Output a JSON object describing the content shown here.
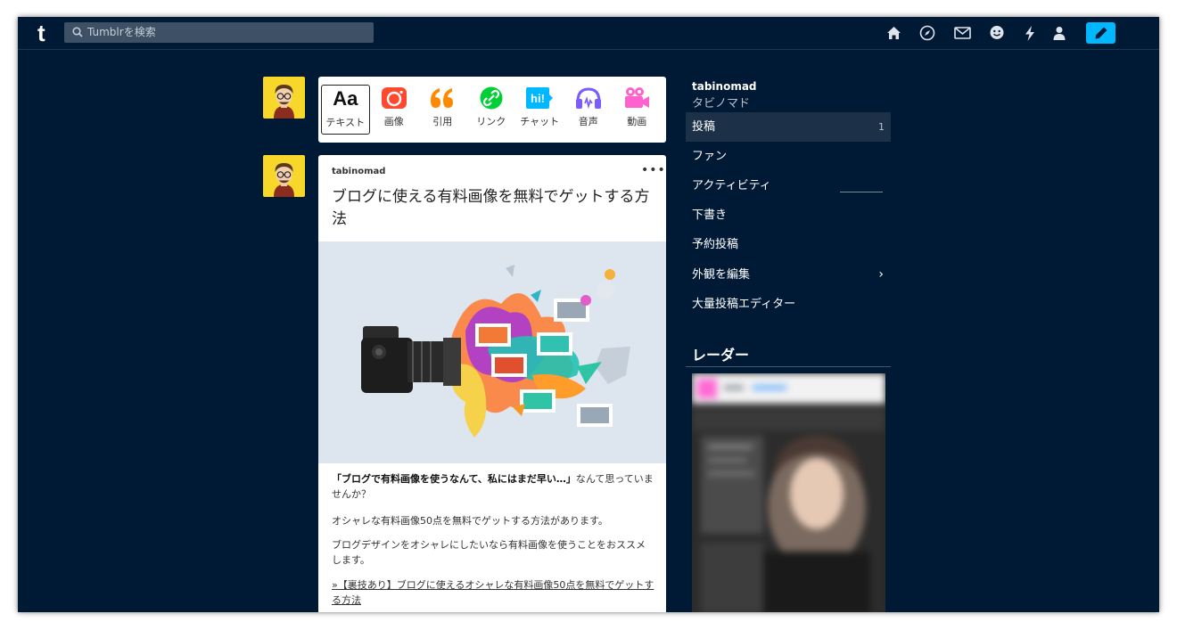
{
  "topbar": {
    "logo": "t",
    "search_placeholder": "Tumblrを検索",
    "icons": [
      "home-icon",
      "explore-icon",
      "inbox-icon",
      "messaging-icon",
      "activity-icon",
      "account-icon",
      "compose-icon"
    ]
  },
  "post_types": [
    {
      "label": "テキスト",
      "icon": "text-icon",
      "glyph": "Aa",
      "color": "#000000"
    },
    {
      "label": "画像",
      "icon": "camera-icon",
      "color": "#ff492f"
    },
    {
      "label": "引用",
      "icon": "quote-icon",
      "glyph": "66",
      "color": "#ff8a00"
    },
    {
      "label": "リンク",
      "icon": "link-icon",
      "color": "#00cf35"
    },
    {
      "label": "チャット",
      "icon": "chat-icon",
      "glyph": "hi!",
      "color": "#00b8ff"
    },
    {
      "label": "音声",
      "icon": "headphones-icon",
      "color": "#7c5cff"
    },
    {
      "label": "動画",
      "icon": "video-camera-icon",
      "color": "#ff62ce"
    }
  ],
  "post": {
    "author": "tabinomad",
    "more": "•••",
    "title": "ブログに使える有料画像を無料でゲットする方法",
    "body_bold": "「ブログで有料画像を使うなんて、私にはまだ早い…」",
    "body_rest": "なんて思っていませんか？",
    "para2": "オシャレな有料画像50点を無料でゲットする方法があります。",
    "para3": "ブログデザインをオシャレにしたいなら有料画像を使うことをおススメします。",
    "link": "»【裏技あり】ブログに使えるオシャレな有料画像50点を無料でゲットする方法"
  },
  "sidebar": {
    "username": "tabinomad",
    "title": "タビノマド",
    "items": [
      {
        "label": "投稿",
        "count": "1"
      },
      {
        "label": "ファン"
      },
      {
        "label": "アクティビティ"
      },
      {
        "label": "下書き"
      },
      {
        "label": "予約投稿"
      },
      {
        "label": "外観を編集",
        "chevron": "›"
      },
      {
        "label": "大量投稿エディター"
      }
    ],
    "radar_title": "レーダー"
  },
  "colors": {
    "background": "#001935",
    "accent": "#00b8ff",
    "search_bg": "#3e5066",
    "avatar_bg": "#f7d729"
  }
}
